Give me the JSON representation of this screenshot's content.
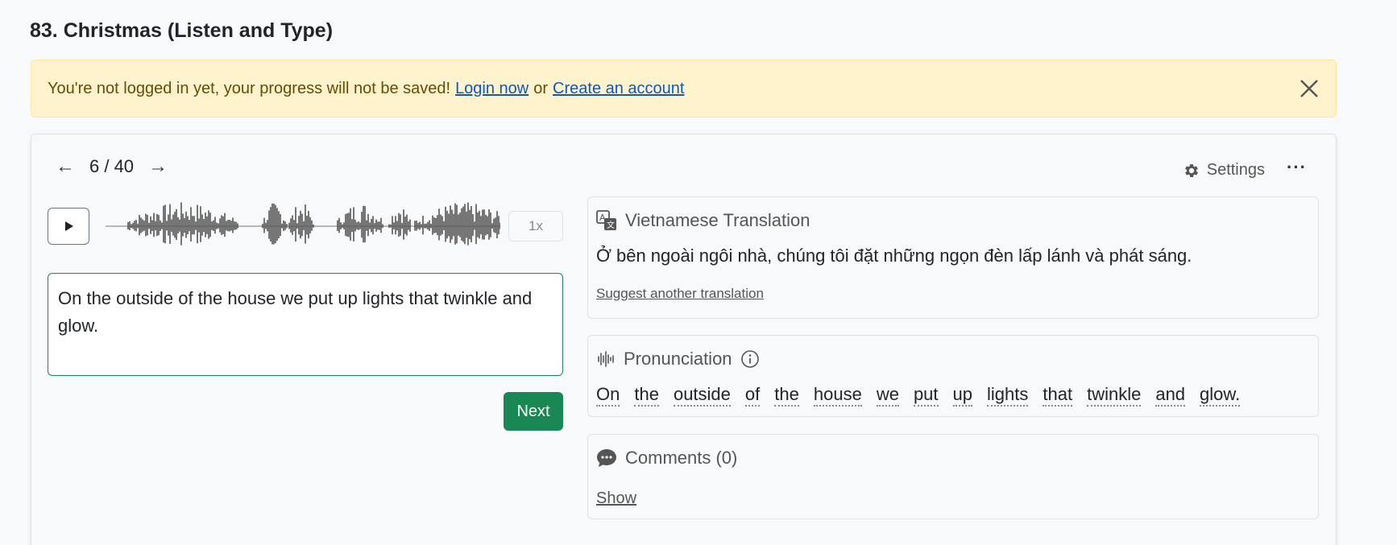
{
  "page": {
    "title": "83. Christmas (Listen and Type)"
  },
  "alert": {
    "message": "You're not logged in yet, your progress will not be saved!",
    "login_label": "Login now",
    "or_text": "or",
    "create_label": "Create an account",
    "close_icon": "close-icon"
  },
  "nav": {
    "prev_icon": "←",
    "counter": "6 / 40",
    "next_icon": "→"
  },
  "toolbar": {
    "settings_label": "Settings",
    "more_label": "···"
  },
  "player": {
    "speed_label": "1x"
  },
  "answer": {
    "text": "On the outside of the house we put up lights that twinkle and glow."
  },
  "next_button": {
    "label": "Next"
  },
  "translation": {
    "title": "Vietnamese Translation",
    "text": "Ở bên ngoài ngôi nhà, chúng tôi đặt những ngọn đèn lấp lánh và phát sáng.",
    "suggest_label": "Suggest another translation"
  },
  "pronunciation": {
    "title": "Pronunciation",
    "words": [
      "On",
      "the",
      "outside",
      "of",
      "the",
      "house",
      "we",
      "put",
      "up",
      "lights",
      "that",
      "twinkle",
      "and",
      "glow."
    ]
  },
  "comments": {
    "title": "Comments (0)",
    "show_label": "Show"
  },
  "colors": {
    "accent": "#198754",
    "alert_bg": "#fff3cd",
    "link": "#0a58ca"
  }
}
